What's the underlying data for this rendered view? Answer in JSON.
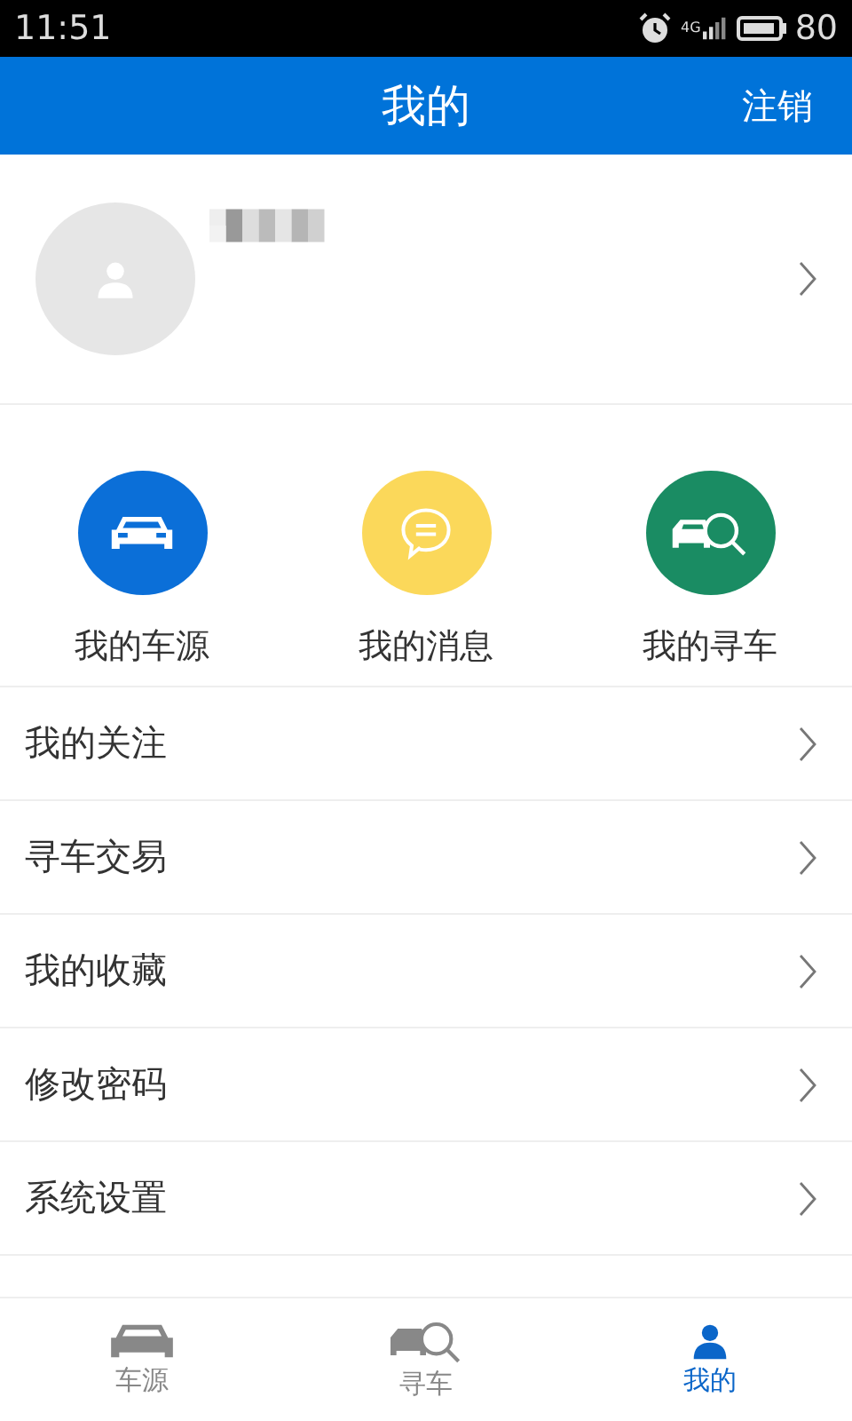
{
  "status_bar": {
    "time": "11:51",
    "network": "4G",
    "battery": "80"
  },
  "header": {
    "title": "我的",
    "action": "注销"
  },
  "shortcuts": [
    {
      "label": "我的车源",
      "kind": "car",
      "color": "#0b6fd8"
    },
    {
      "label": "我的消息",
      "kind": "message",
      "color": "#fbd85a"
    },
    {
      "label": "我的寻车",
      "kind": "search-car",
      "color": "#1a8c63"
    }
  ],
  "menu": [
    {
      "label": "我的关注"
    },
    {
      "label": "寻车交易"
    },
    {
      "label": "我的收藏"
    },
    {
      "label": "修改密码"
    },
    {
      "label": "系统设置"
    }
  ],
  "tabs": [
    {
      "label": "车源",
      "kind": "car",
      "selected": false
    },
    {
      "label": "寻车",
      "kind": "search-car",
      "selected": false
    },
    {
      "label": "我的",
      "kind": "person",
      "selected": true
    }
  ]
}
